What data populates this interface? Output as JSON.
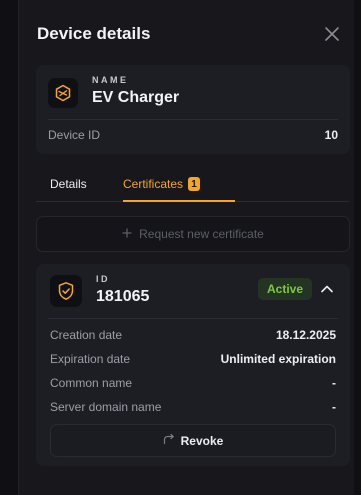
{
  "header": {
    "title": "Device details"
  },
  "device": {
    "name_label": "NAME",
    "name": "EV Charger",
    "id_label": "Device ID",
    "id_value": "10"
  },
  "tabs": [
    {
      "label": "Details"
    },
    {
      "label": "Certificates",
      "badge": "1",
      "active": true
    }
  ],
  "request_button": {
    "label": "Request new certificate"
  },
  "certificate": {
    "id_label": "ID",
    "id": "181065",
    "status": "Active",
    "rows": [
      {
        "label": "Creation date",
        "value": "18.12.2025"
      },
      {
        "label": "Expiration date",
        "value": "Unlimited expiration"
      },
      {
        "label": "Common name",
        "value": "-"
      },
      {
        "label": "Server domain name",
        "value": "-"
      }
    ],
    "revoke_label": "Revoke"
  },
  "colors": {
    "accent": "#f5a623",
    "status_active": "#7cc940",
    "background": "#17171c",
    "card": "#1d1e24"
  },
  "icons": [
    "close-icon",
    "device-hexagon-icon",
    "plus-icon",
    "certificate-shield-icon",
    "chevron-up-icon",
    "revoke-icon"
  ]
}
